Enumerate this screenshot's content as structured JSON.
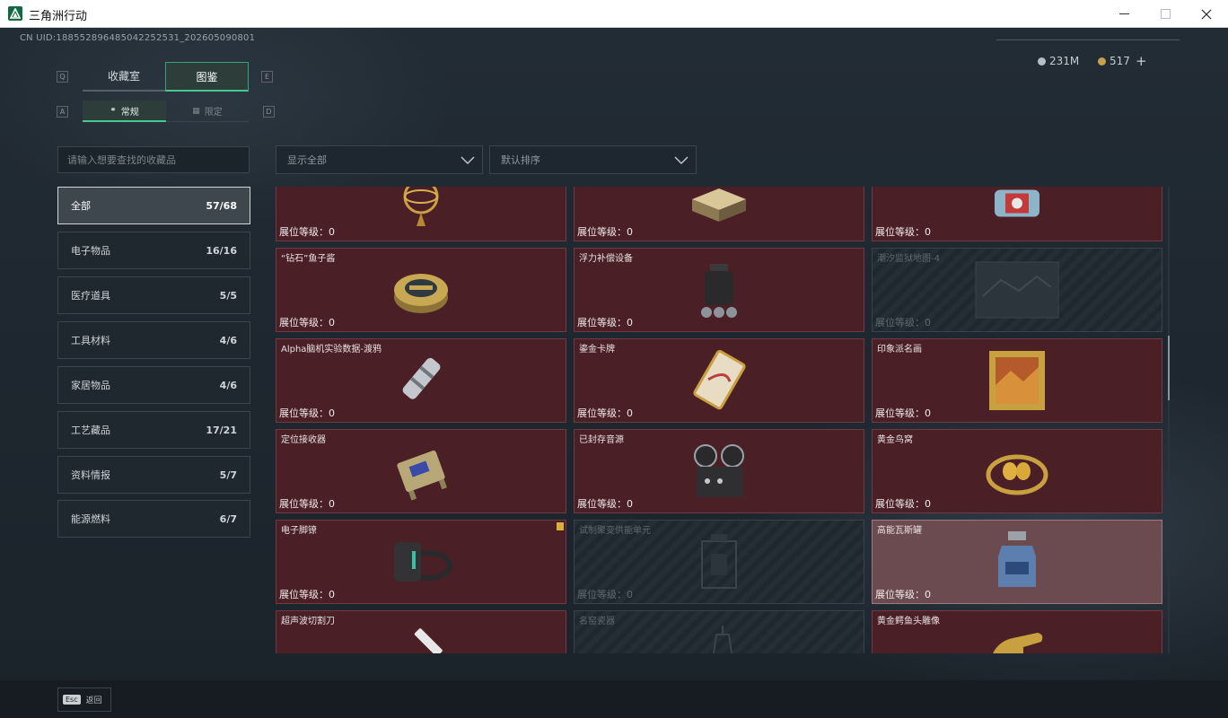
{
  "window": {
    "title": "三角洲行动"
  },
  "header": {
    "uid": "CN UID:1885528964850422525​31_202605090801",
    "tabs": [
      {
        "label": "收藏室"
      },
      {
        "label": "图鉴"
      }
    ],
    "tab_keys": {
      "left": "Q",
      "right": "E"
    },
    "subtabs": [
      {
        "label": "常规"
      },
      {
        "label": "限定"
      }
    ],
    "subtab_keys": {
      "left": "A",
      "right": "D"
    },
    "currency": [
      {
        "icon": "silver-coin-icon",
        "value": "231M"
      },
      {
        "icon": "gold-coin-icon",
        "value": "517"
      }
    ],
    "add_symbol": "+"
  },
  "search": {
    "placeholder": "请输入想要查找的收藏品",
    "value": ""
  },
  "filters": {
    "display": "显示全部",
    "sort": "默认排序"
  },
  "categories": [
    {
      "label": "全部",
      "count": "57/68"
    },
    {
      "label": "电子物品",
      "count": "16/16"
    },
    {
      "label": "医疗道具",
      "count": "5/5"
    },
    {
      "label": "工具材料",
      "count": "4/6"
    },
    {
      "label": "家居物品",
      "count": "4/6"
    },
    {
      "label": "工艺藏品",
      "count": "17/21"
    },
    {
      "label": "资料情报",
      "count": "5/7"
    },
    {
      "label": "能源燃料",
      "count": "6/7"
    }
  ],
  "items": [
    {
      "name": "",
      "level": "展位等级：0",
      "icon": "armillary-sphere-icon"
    },
    {
      "name": "",
      "level": "展位等级：0",
      "icon": "chess-box-icon"
    },
    {
      "name": "",
      "level": "展位等级：0",
      "icon": "machine-part-icon"
    },
    {
      "name": "“钻石”鱼子酱",
      "level": "展位等级：0",
      "icon": "caviar-tin-icon"
    },
    {
      "name": "浮力补偿设备",
      "level": "展位等级：0",
      "icon": "buoyancy-device-icon"
    },
    {
      "name": "潮汐监狱地图-4",
      "level": "展位等级：0",
      "icon": "map-icon"
    },
    {
      "name": "Alpha脑机实验数据-渡鸦",
      "level": "展位等级：0",
      "icon": "data-capsule-icon"
    },
    {
      "name": "鎏金卡牌",
      "level": "展位等级：0",
      "icon": "gilded-card-icon"
    },
    {
      "name": "印象派名画",
      "level": "展位等级：0",
      "icon": "painting-icon"
    },
    {
      "name": "定位接收器",
      "level": "展位等级：0",
      "icon": "receiver-icon"
    },
    {
      "name": "已封存音源",
      "level": "展位等级：0",
      "icon": "reel-recorder-icon"
    },
    {
      "name": "黄金鸟窝",
      "level": "展位等级：0",
      "icon": "golden-nest-icon"
    },
    {
      "name": "电子脚镣",
      "level": "展位等级：0",
      "icon": "ankle-monitor-icon"
    },
    {
      "name": "试制聚变供能单元",
      "level": "展位等级：0",
      "icon": "fusion-cell-icon"
    },
    {
      "name": "高能瓦斯罐",
      "level": "展位等级：0",
      "icon": "gas-canister-icon"
    },
    {
      "name": "超声波切割刀",
      "level": "",
      "icon": "ultrasonic-knife-icon"
    },
    {
      "name": "名窑瓷器",
      "level": "",
      "icon": "porcelain-icon"
    },
    {
      "name": "黄金鳄鱼头雕像",
      "level": "",
      "icon": "gold-croc-statue-icon"
    }
  ],
  "footer": {
    "esc_key": "Esc",
    "back_label": "返回"
  }
}
